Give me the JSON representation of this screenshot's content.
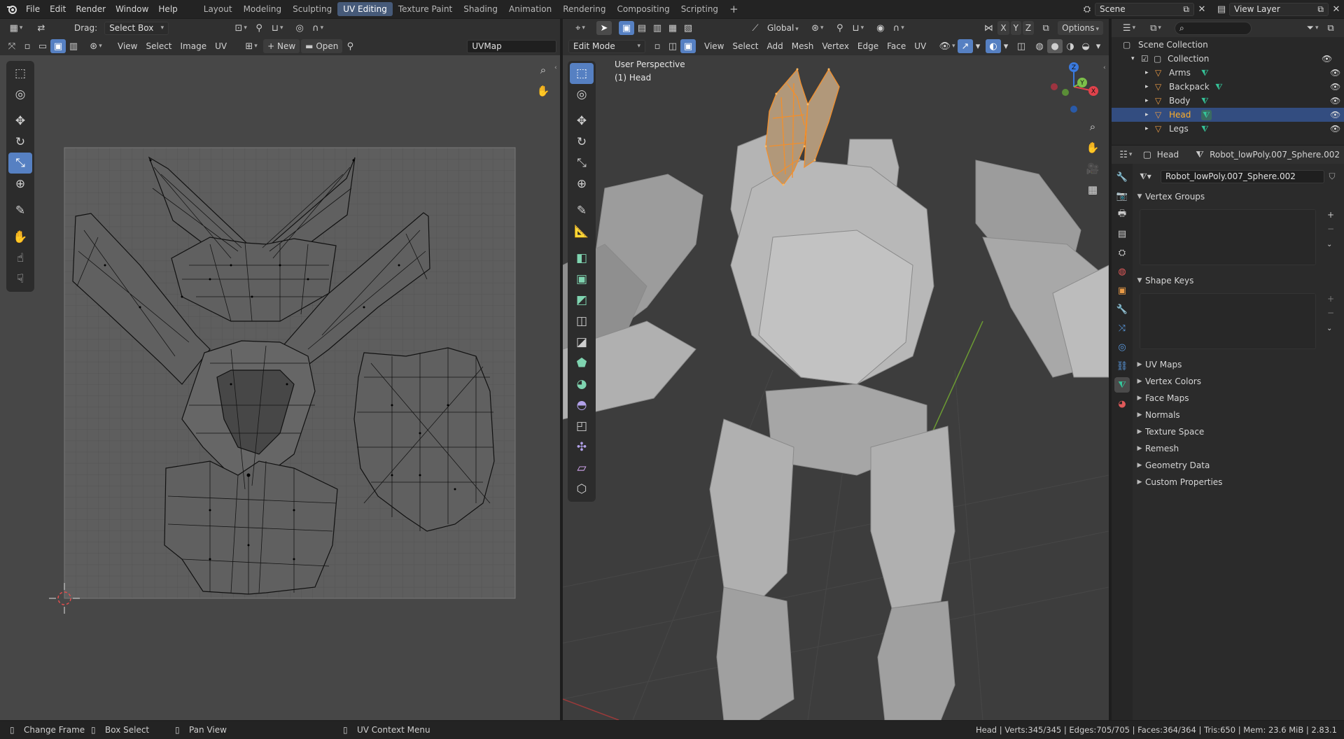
{
  "topbar": {
    "menus": [
      "File",
      "Edit",
      "Render",
      "Window",
      "Help"
    ],
    "workspaces": [
      "Layout",
      "Modeling",
      "Sculpting",
      "UV Editing",
      "Texture Paint",
      "Shading",
      "Animation",
      "Rendering",
      "Compositing",
      "Scripting"
    ],
    "active_workspace": "UV Editing",
    "add_tab": "+",
    "scene_name": "Scene",
    "view_layer": "View Layer"
  },
  "uv_editor": {
    "drag_label": "Drag:",
    "drag_mode": "Select Box",
    "menus": [
      "View",
      "Select",
      "Image",
      "UV"
    ],
    "new_label": "New",
    "open_label": "Open",
    "uvmap_name": "UVMap"
  },
  "viewport": {
    "transform_orientation": "Global",
    "axes": [
      "X",
      "Y",
      "Z"
    ],
    "options_label": "Options",
    "mode": "Edit Mode",
    "menus": [
      "View",
      "Select",
      "Add",
      "Mesh",
      "Vertex",
      "Edge",
      "Face",
      "UV"
    ],
    "perspective": "User Perspective",
    "active_object": "(1) Head",
    "gizmo": {
      "x": "X",
      "y": "Y",
      "z": "Z"
    }
  },
  "outliner": {
    "search_placeholder": "",
    "root": "Scene Collection",
    "collection": "Collection",
    "objects": [
      "Arms",
      "Backpack",
      "Body",
      "Head",
      "Legs"
    ],
    "selected": "Head"
  },
  "properties": {
    "object_name": "Head",
    "mesh_name": "Robot_lowPoly.007_Sphere.002",
    "data_field": "Robot_lowPoly.007_Sphere.002",
    "open_panels": [
      "Vertex Groups",
      "Shape Keys"
    ],
    "closed_panels": [
      "UV Maps",
      "Vertex Colors",
      "Face Maps",
      "Normals",
      "Texture Space",
      "Remesh",
      "Geometry Data",
      "Custom Properties"
    ]
  },
  "statusbar": {
    "items": [
      "Change Frame",
      "Box Select",
      "Pan View",
      "UV Context Menu"
    ],
    "stats": "Head | Verts:345/345 | Edges:705/705 | Faces:364/364 | Tris:650 | Mem: 23.6 MiB | 2.83.1"
  },
  "colors": {
    "accent": "#5680c2",
    "selection_orange": "#f28f2c",
    "selected_row": "#334d80",
    "mesh_icon_green": "#35c59a",
    "object_icon_orange": "#e89a46"
  }
}
